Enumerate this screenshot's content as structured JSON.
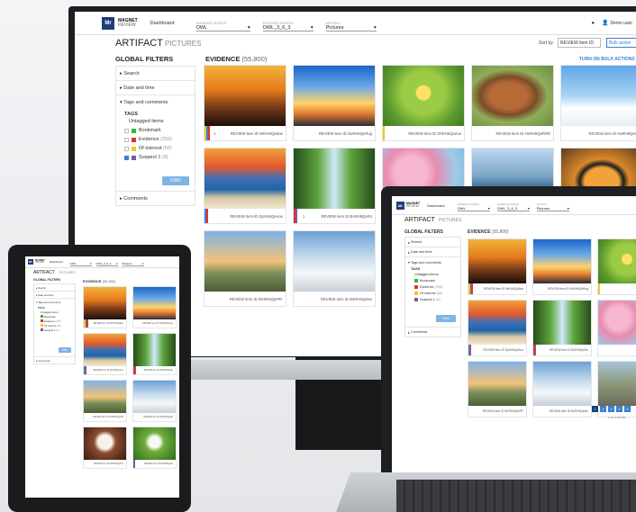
{
  "app": {
    "logo_text": "Mr",
    "brand_line1": "MAGNET",
    "brand_line2": "REVIEW",
    "nav_dashboard": "Dashboard",
    "case_label": "Evidence source",
    "case_value": "OWL",
    "source_label": "Evidence source",
    "source_value": "OWL_3_6_3",
    "artifact_label": "Artifact",
    "artifact_value": "Pictures",
    "user_name": "Demo user",
    "tab_artifact": "ARTIFACT",
    "tab_pictures": "PICTURES",
    "sort_label": "Sort by",
    "sort_value": "REVIEW item ID",
    "action_button": "Bulk action",
    "filters_title": "GLOBAL FILTERS",
    "filter_search": "Search",
    "filter_date": "Date and time",
    "filter_tags": "Tags and comments",
    "tags_header": "TAGS",
    "tag_untagged": "Untagged items",
    "tag_bookmark": "Bookmark",
    "tag_evidence": "Evidence",
    "tag_evidence_count": "(256)",
    "tag_interest": "Of interest",
    "tag_interest_count": "(65)",
    "tag_suspect": "Suspect 1",
    "tag_suspect_count": "(8)",
    "find_button": "FIND",
    "filter_comments": "Comments",
    "evidence_title": "EVIDENCE",
    "evidence_count": "(55,800)",
    "bulk_action": "TURN ON BULK ACTIONS",
    "caption_prefix": "REVIEW item ID",
    "badge_count": "1",
    "pagination_text": "1-15 of 55,800",
    "pages": [
      "1",
      "2",
      "3",
      "4",
      "5"
    ]
  },
  "colors": {
    "brand": "#1d3f78",
    "bookmark": "#2bbb36",
    "evidence": "#e0322c",
    "interest": "#f4c71d",
    "suspect": "#7a59a8",
    "accent": "#3a7fd0",
    "find": "#7fb3e3"
  },
  "monitor_cards": [
    {
      "img": "concert",
      "id": "WrHX6Qe6an",
      "tag": "multi",
      "badge": true
    },
    {
      "img": "eiffel",
      "id": "NoRH6QeRug",
      "tag": ""
    },
    {
      "img": "dandelion",
      "id": "DhRH6QeZuo",
      "tag": "interest"
    },
    {
      "img": "cow",
      "id": "HeRH6QeRRR",
      "tag": ""
    },
    {
      "img": "snowman",
      "id": "NeRH6QeCy",
      "tag": ""
    },
    {
      "img": "beach",
      "id": "DpHX6QeAoe",
      "tag": "multi2"
    },
    {
      "img": "waterfall",
      "id": "BoRH6QeRo",
      "tag": "evidence",
      "badge": true
    },
    {
      "img": "blossom",
      "id": "",
      "tag": ""
    },
    {
      "img": "lake",
      "id": "",
      "tag": ""
    },
    {
      "img": "tiger",
      "id": "",
      "tag": ""
    },
    {
      "img": "sunsetpark",
      "id": "WHRX6QePIF",
      "tag": ""
    },
    {
      "img": "snowpark",
      "id": "BoRH6QeMo",
      "tag": ""
    }
  ],
  "laptop_cards": [
    {
      "img": "concert",
      "id": "WrHX6Qe6an",
      "tag": "multi"
    },
    {
      "img": "eiffel",
      "id": "NoRH6QeRug",
      "tag": ""
    },
    {
      "img": "dandelion",
      "id": "",
      "tag": "interest"
    },
    {
      "img": "beach",
      "id": "DpHX6QeAoe",
      "tag": "multi2"
    },
    {
      "img": "waterfall",
      "id": "BoRH6QeRo",
      "tag": "evidence"
    },
    {
      "img": "blossom",
      "id": "",
      "tag": ""
    },
    {
      "img": "sunsetpark",
      "id": "WHRX6QePIF",
      "tag": ""
    },
    {
      "img": "snowpark",
      "id": "BoRH6QeMo",
      "tag": ""
    },
    {
      "img": "elephant",
      "id": "",
      "tag": ""
    }
  ],
  "tablet_cards": [
    {
      "img": "concert",
      "id": "WrHX6Qe6an",
      "tag": "multi"
    },
    {
      "img": "eiffel",
      "id": "NoRH6QeRug",
      "tag": ""
    },
    {
      "img": "beach",
      "id": "DpHX6QeAoe",
      "tag": "multi2"
    },
    {
      "img": "waterfall",
      "id": "BoRH6QeRo",
      "tag": "evidence"
    },
    {
      "img": "sunsetpark",
      "id": "WHRX6QePIF",
      "tag": ""
    },
    {
      "img": "snowpark",
      "id": "BoRH6QeMo",
      "tag": ""
    },
    {
      "img": "cave",
      "id": "WrHX6QeTkx",
      "tag": ""
    },
    {
      "img": "lotus",
      "id": "BoRH6Qe6a",
      "tag": "suspect"
    }
  ]
}
